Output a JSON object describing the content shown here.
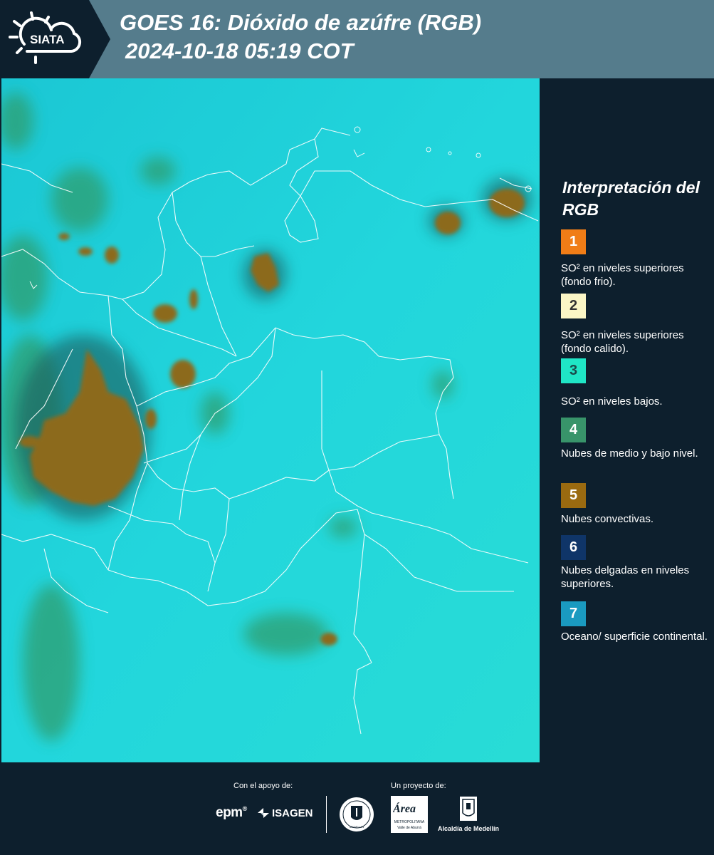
{
  "header": {
    "logo_text": "SIATA",
    "title_line1": "GOES 16: Dióxido de azúfre (RGB)",
    "title_line2": "2024-10-18 05:19 COT"
  },
  "legend": {
    "title": "Interpretación del RGB",
    "items": [
      {
        "num": "1",
        "color": "#f07d17",
        "text_color": "#ffffff",
        "text": "SO² en niveles superiores (fondo frio)."
      },
      {
        "num": "2",
        "color": "#fbf6c6",
        "text_color": "#333333",
        "text": "SO² en niveles superiores (fondo calido)."
      },
      {
        "num": "3",
        "color": "#1fe6c6",
        "text_color": "#1a4a4a",
        "text": "SO² en niveles bajos."
      },
      {
        "num": "4",
        "color": "#38946a",
        "text_color": "#ffffff",
        "text": "Nubes de medio y bajo nivel."
      },
      {
        "num": "5",
        "color": "#9a6a10",
        "text_color": "#ffffff",
        "text": "Nubes convectivas."
      },
      {
        "num": "6",
        "color": "#0f3568",
        "text_color": "#ffffff",
        "text": "Nubes delgadas en niveles superiores."
      },
      {
        "num": "7",
        "color": "#1a9ac0",
        "text_color": "#ffffff",
        "text": "Oceano/ superficie continental."
      }
    ]
  },
  "footer": {
    "support_label": "Con el apoyo de:",
    "project_label": "Un proyecto de:",
    "sponsors": [
      "epm",
      "ISAGEN"
    ],
    "partners": [
      "Área Metropolitana",
      "Alcaldía de Medellín"
    ],
    "area_sub": "METROPOLITANA",
    "area_sub2": "Valle de Aburrá",
    "medellin_seal": "MEDELLIN"
  },
  "map": {
    "background_color": "#1ecfd6",
    "convective_color": "#8c6a1c",
    "lowcloud_color": "#2fa06a",
    "border_color": "#ffffff"
  }
}
